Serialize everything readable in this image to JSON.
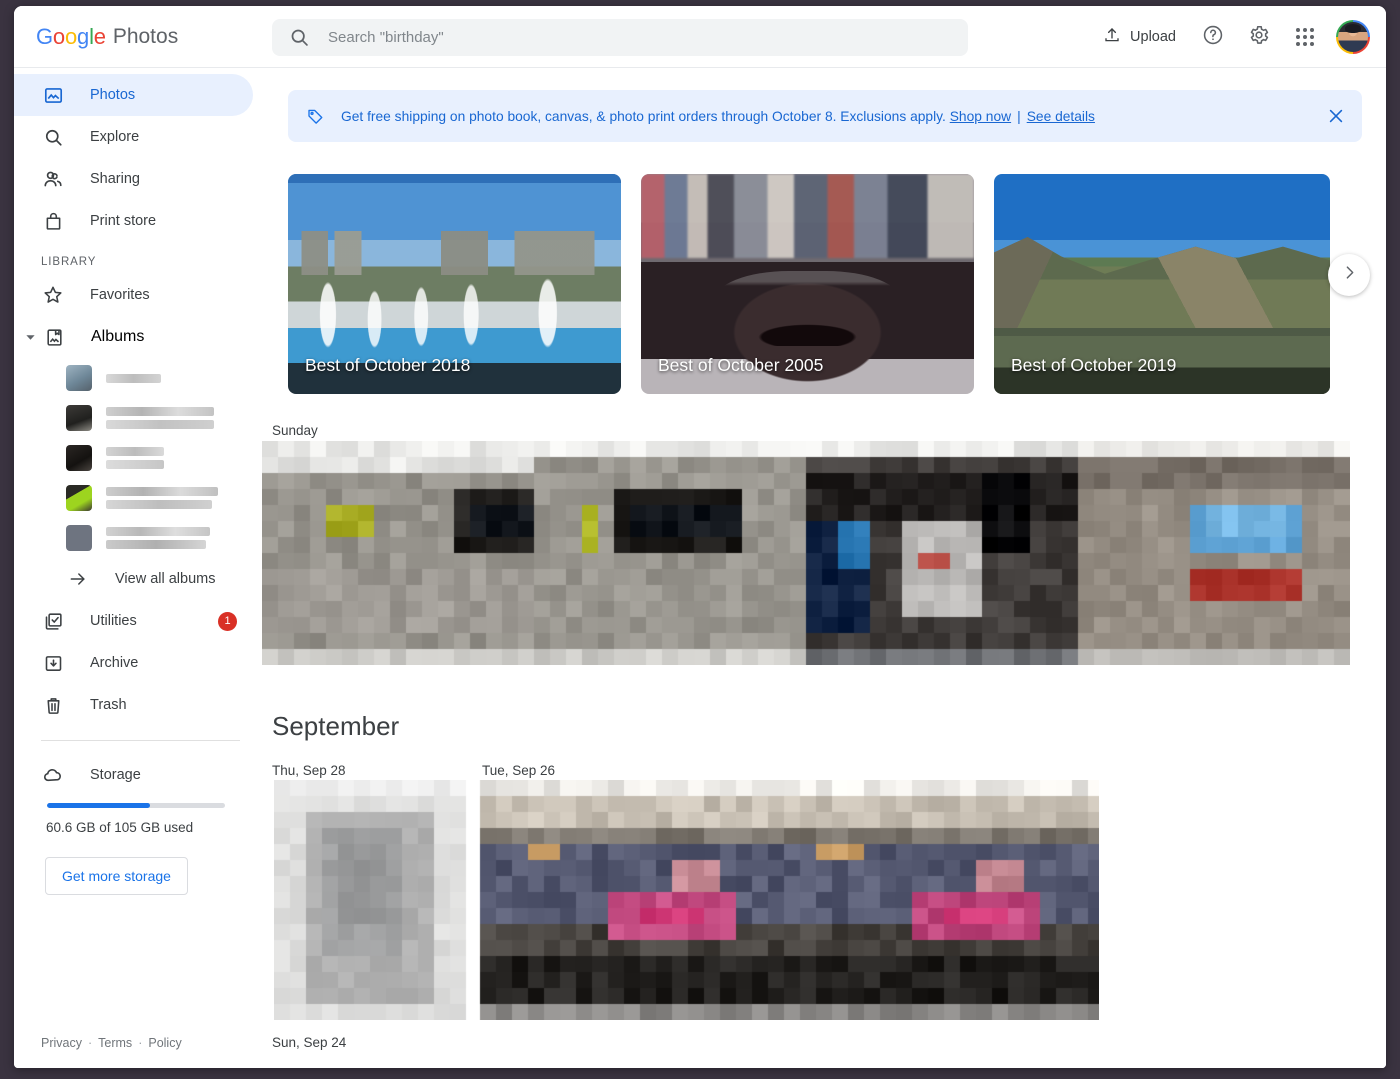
{
  "header": {
    "brand_google": "Google",
    "brand_product": "Photos",
    "search_placeholder": "Search \"birthday\"",
    "upload_label": "Upload",
    "icons": {
      "search": "search-icon",
      "upload": "upload-icon",
      "help": "help-icon",
      "settings": "gear-icon",
      "apps": "apps-grid-icon",
      "avatar": "user-avatar"
    }
  },
  "sidebar": {
    "primary": [
      {
        "label": "Photos",
        "icon": "photo-icon",
        "active": true
      },
      {
        "label": "Explore",
        "icon": "search-icon",
        "active": false
      },
      {
        "label": "Sharing",
        "icon": "people-icon",
        "active": false
      },
      {
        "label": "Print store",
        "icon": "shopping-bag-icon",
        "active": false
      }
    ],
    "library_label": "LIBRARY",
    "library": [
      {
        "label": "Favorites",
        "icon": "star-icon"
      },
      {
        "label": "Albums",
        "icon": "album-book-icon",
        "expanded": true
      }
    ],
    "albums": [
      {
        "redacted": true,
        "line_widths": [
          55
        ],
        "thumb": "#93a7b5"
      },
      {
        "redacted": true,
        "line_widths": [
          108,
          108
        ],
        "thumb": "#2e2c2a"
      },
      {
        "redacted": true,
        "line_widths": [
          58,
          58
        ],
        "thumb": "#1d1a17"
      },
      {
        "redacted": true,
        "line_widths": [
          112,
          106
        ],
        "thumb": "#4c6b22"
      },
      {
        "redacted": true,
        "line_widths": [
          104,
          100
        ],
        "thumb": "#6e7480"
      }
    ],
    "view_all_label": "View all albums",
    "secondary": [
      {
        "label": "Utilities",
        "icon": "utilities-icon",
        "badge": "1"
      },
      {
        "label": "Archive",
        "icon": "archive-icon",
        "badge": ""
      },
      {
        "label": "Trash",
        "icon": "trash-icon",
        "badge": ""
      }
    ],
    "storage": {
      "label": "Storage",
      "icon": "cloud-icon",
      "used_text": "60.6 GB of 105 GB used",
      "percent": 58,
      "button_label": "Get more storage",
      "bar_color": "#1a73e8"
    },
    "footer": {
      "privacy": "Privacy",
      "terms": "Terms",
      "policy": "Policy",
      "separator": "·"
    }
  },
  "main": {
    "promo": {
      "icon": "tag-icon",
      "text": "Get free shipping on photo book, canvas, & photo print orders through October 8. Exclusions apply.",
      "link_shop": "Shop now",
      "link_details": "See details",
      "divider": "|",
      "close_icon": "close-icon",
      "background": "#e8f0fe",
      "text_color": "#1967d2"
    },
    "memories": [
      {
        "label": "Best of October 2018",
        "art": "art-fountain"
      },
      {
        "label": "Best of October 2005",
        "art": "art-car"
      },
      {
        "label": "Best of October 2019",
        "art": "art-lake"
      }
    ],
    "carousel_next_icon": "chevron-right-icon",
    "sections": [
      {
        "day_label": "Sunday",
        "photos_redacted": true
      },
      {
        "month_title": "September",
        "day_labels": [
          "Thu, Sep 28",
          "Tue, Sep 26"
        ],
        "photos_redacted": true
      },
      {
        "day_label": "Sun, Sep 24",
        "photos_redacted": true
      }
    ]
  },
  "colors": {
    "accent_blue": "#1a73e8",
    "active_pill": "#e8f0fe",
    "badge_red": "#d93025",
    "window_border": "#3a3340"
  }
}
